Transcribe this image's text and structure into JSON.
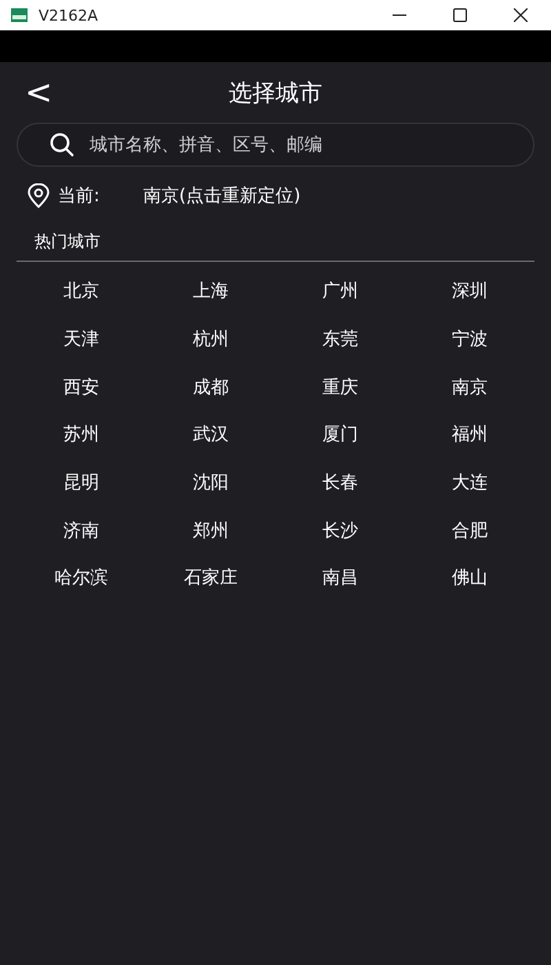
{
  "window": {
    "title": "V2162A"
  },
  "header": {
    "back": "<",
    "title": "选择城市"
  },
  "search": {
    "placeholder": "城市名称、拼音、区号、邮编"
  },
  "current": {
    "label": "当前:",
    "value": "南京(点击重新定位)"
  },
  "hot_cities": {
    "title": "热门城市",
    "items": [
      "北京",
      "上海",
      "广州",
      "深圳",
      "天津",
      "杭州",
      "东莞",
      "宁波",
      "西安",
      "成都",
      "重庆",
      "南京",
      "苏州",
      "武汉",
      "厦门",
      "福州",
      "昆明",
      "沈阳",
      "长春",
      "大连",
      "济南",
      "郑州",
      "长沙",
      "合肥",
      "哈尔滨",
      "石家庄",
      "南昌",
      "佛山"
    ]
  }
}
